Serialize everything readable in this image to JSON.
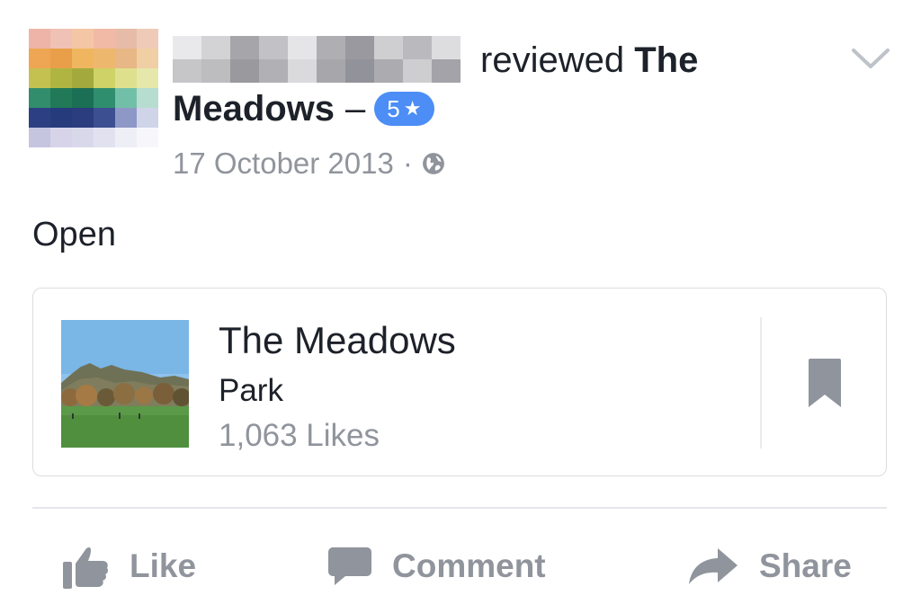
{
  "post": {
    "action_text": "reviewed",
    "page_name_first": "The",
    "page_name_second": "Meadows",
    "dash": "–",
    "rating_value": "5",
    "rating_star": "★",
    "date": "17 October 2013",
    "separator": "·",
    "privacy_icon": "globe-icon",
    "menu_icon": "chevron-down-icon"
  },
  "body": {
    "text": "Open"
  },
  "card": {
    "title": "The Meadows",
    "category": "Park",
    "likes": "1,063 Likes",
    "save_icon": "bookmark-icon"
  },
  "actions": {
    "like_label": "Like",
    "comment_label": "Comment",
    "share_label": "Share"
  },
  "colors": {
    "rating_badge": "#4c8df6",
    "muted_text": "#90949c",
    "icon_gray": "#90949c"
  }
}
